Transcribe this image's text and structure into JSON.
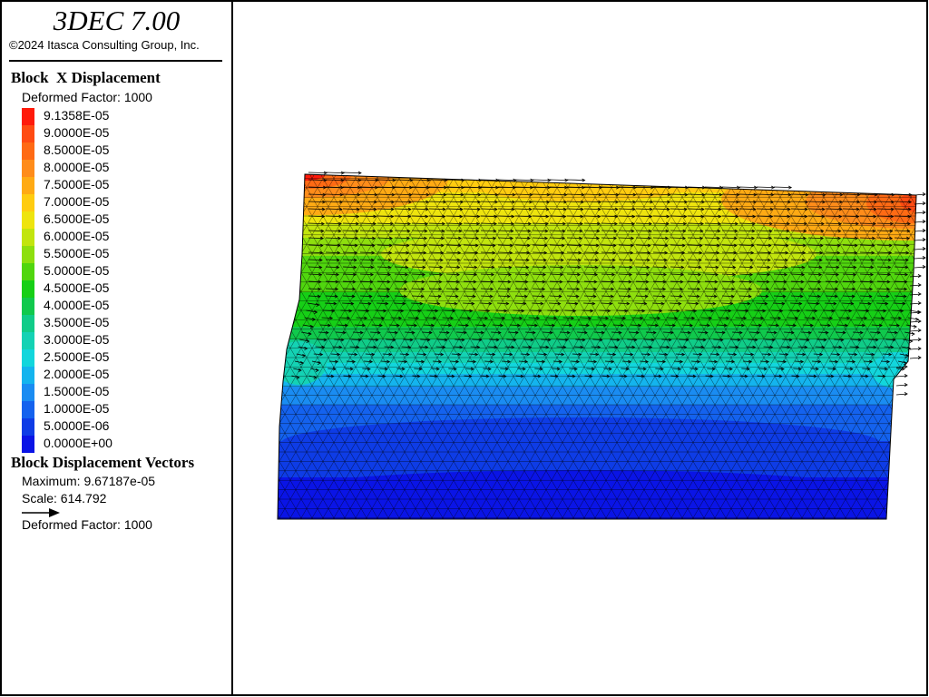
{
  "app": {
    "title": "3DEC 7.00",
    "copyright": "©2024 Itasca Consulting Group, Inc."
  },
  "contour": {
    "title": "Block  X Displacement",
    "deformed_factor": "Deformed Factor: 1000",
    "levels": [
      {
        "label": "9.1358E-05",
        "color": "#ff1a0a"
      },
      {
        "label": "9.0000E-05",
        "color": "#ff4b12"
      },
      {
        "label": "8.5000E-05",
        "color": "#ff6a14"
      },
      {
        "label": "8.0000E-05",
        "color": "#ff8c1a"
      },
      {
        "label": "7.5000E-05",
        "color": "#ffaa14"
      },
      {
        "label": "7.0000E-05",
        "color": "#ffcc10"
      },
      {
        "label": "6.5000E-05",
        "color": "#eee40e"
      },
      {
        "label": "6.0000E-05",
        "color": "#c2e50e"
      },
      {
        "label": "5.5000E-05",
        "color": "#8edf0e"
      },
      {
        "label": "5.0000E-05",
        "color": "#50d60e"
      },
      {
        "label": "4.5000E-05",
        "color": "#16cf16"
      },
      {
        "label": "4.0000E-05",
        "color": "#10c94c"
      },
      {
        "label": "3.5000E-05",
        "color": "#10cc88"
      },
      {
        "label": "3.0000E-05",
        "color": "#14d2b4"
      },
      {
        "label": "2.5000E-05",
        "color": "#12d6dc"
      },
      {
        "label": "2.0000E-05",
        "color": "#14b4ee"
      },
      {
        "label": "1.5000E-05",
        "color": "#1a8cf2"
      },
      {
        "label": "1.0000E-05",
        "color": "#1462ee"
      },
      {
        "label": "5.0000E-06",
        "color": "#0e3ce6"
      },
      {
        "label": "0.0000E+00",
        "color": "#0a14e6"
      }
    ]
  },
  "vectors": {
    "title": "Block Displacement Vectors",
    "maximum": "Maximum: 9.67187e-05",
    "scale": "Scale: 614.792",
    "deformed_factor": "Deformed Factor: 1000"
  },
  "view": {
    "mesh_color": "#000000",
    "vector_color": "#000000",
    "border_color": "#000000"
  }
}
